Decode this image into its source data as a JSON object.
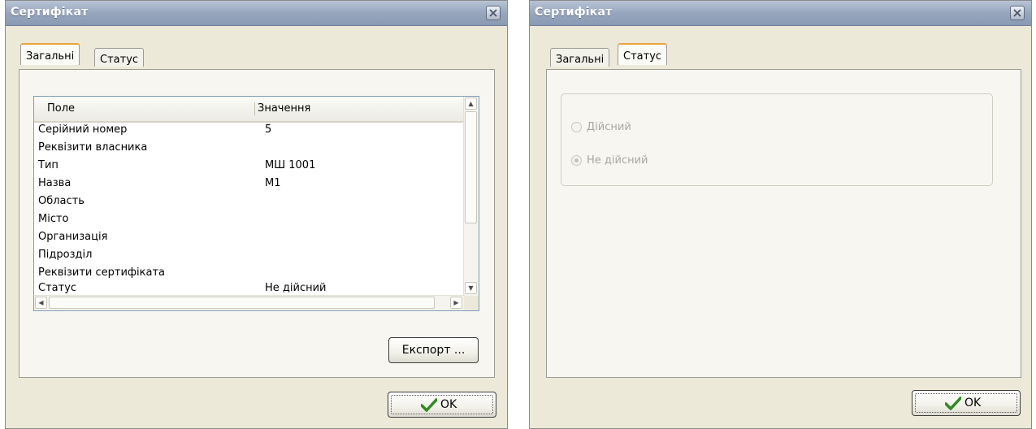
{
  "dialog_left": {
    "title": "Сертифікат",
    "tabs": [
      {
        "label": "Загальні",
        "active": true
      },
      {
        "label": "Статус",
        "active": false
      }
    ],
    "list": {
      "headers": {
        "field": "Поле",
        "value": "Значення"
      },
      "rows": [
        {
          "field": "Серійний номер",
          "value": "5"
        },
        {
          "field": "Реквізити власника",
          "value": ""
        },
        {
          "field": "Тип",
          "value": "МШ 1001"
        },
        {
          "field": "Назва",
          "value": "М1"
        },
        {
          "field": "Область",
          "value": ""
        },
        {
          "field": "Місто",
          "value": ""
        },
        {
          "field": "Организація",
          "value": ""
        },
        {
          "field": "Підрозділ",
          "value": ""
        },
        {
          "field": "Реквізити сертифіката",
          "value": ""
        },
        {
          "field": "Статус",
          "value": "Не дійсний"
        }
      ]
    },
    "export_label": "Експорт ...",
    "ok_label": "OK"
  },
  "dialog_right": {
    "title": "Сертифікат",
    "tabs": [
      {
        "label": "Загальні",
        "active": false
      },
      {
        "label": "Статус",
        "active": true
      }
    ],
    "status_options": [
      {
        "label": "Дійсний",
        "selected": false
      },
      {
        "label": "Не дійсний",
        "selected": true
      }
    ],
    "ok_label": "OK"
  },
  "colors": {
    "ok_check": "#2e8b1f",
    "tab_highlight": "#e8a33a",
    "titlebar": "#97a6bd"
  },
  "icons": [
    "close-icon",
    "checkmark-icon",
    "scroll-up-icon",
    "scroll-down-icon",
    "scroll-left-icon",
    "scroll-right-icon"
  ]
}
